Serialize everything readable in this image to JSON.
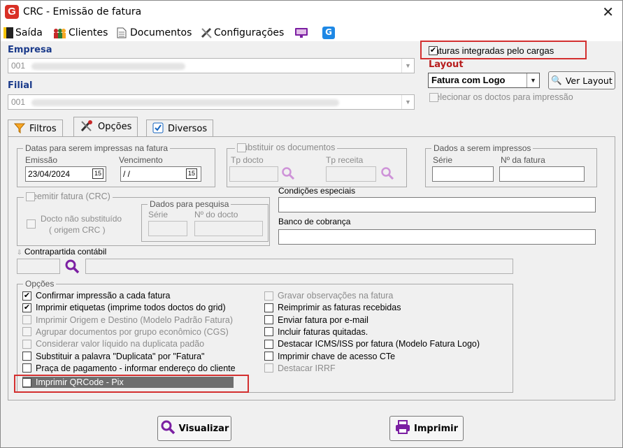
{
  "window": {
    "title": "CRC - Emissão de fatura",
    "close": "✕"
  },
  "menu": {
    "saida": "Saída",
    "clientes": "Clientes",
    "documentos": "Documentos",
    "configuracoes": "Configurações"
  },
  "empresa": {
    "label": "Empresa",
    "value": "001"
  },
  "filial": {
    "label": "Filial",
    "value": "001"
  },
  "faturas_integradas": "Faturas integradas pelo cargas",
  "layout": {
    "label": "Layout",
    "value": "Fatura com Logo",
    "ver_layout": "Ver Layout",
    "selecionar": "Selecionar os doctos para impressão"
  },
  "tabs": {
    "filtros": "Filtros",
    "opcoes": "Opções",
    "diversos": "Diversos"
  },
  "datas": {
    "legend": "Datas para serem impressas na fatura",
    "emissao_label": "Emissão",
    "emissao_value": "23/04/2024",
    "vencimento_label": "Vencimento",
    "vencimento_value": " / /",
    "cal": "15"
  },
  "substituir": {
    "label": "Substituir os documentos",
    "tp_docto": "Tp docto",
    "tp_receita": "Tp receita"
  },
  "dados_impressos": {
    "legend": "Dados a serem impressos",
    "serie": "Série",
    "numero": "Nº da fatura"
  },
  "reemitir": {
    "label": "Reemitir fatura (CRC)",
    "docto_nao_sub": "Docto não substituído",
    "origem": "( origem CRC )"
  },
  "dados_pesquisa": {
    "legend": "Dados para pesquisa",
    "serie": "Série",
    "numero": "Nº do docto"
  },
  "condicoes": "Condições especiais",
  "banco": "Banco de cobrança",
  "contrapartida": "Contrapartida contábil",
  "opcoes": {
    "legend": "Opções",
    "left": [
      {
        "label": "Confirmar impressão a cada fatura",
        "checked": true,
        "enabled": true
      },
      {
        "label": "Imprimir etiquetas (imprime todos doctos do grid)",
        "checked": true,
        "enabled": true
      },
      {
        "label": "Imprimir Origem e Destino (Modelo Padrão Fatura)",
        "checked": false,
        "enabled": false
      },
      {
        "label": "Agrupar documentos por grupo econômico (CGS)",
        "checked": false,
        "enabled": false
      },
      {
        "label": "Considerar valor líquido na duplicata padão",
        "checked": false,
        "enabled": false
      },
      {
        "label": "Substituir a palavra \"Duplicata\" por \"Fatura\"",
        "checked": false,
        "enabled": true
      },
      {
        "label": "Praça de pagamento - informar endereço do cliente",
        "checked": false,
        "enabled": true
      },
      {
        "label": "Imprimir QRCode - Pix",
        "checked": true,
        "enabled": true
      }
    ],
    "right": [
      {
        "label": "Gravar observações na fatura",
        "checked": false,
        "enabled": false
      },
      {
        "label": "Reimprimir as faturas recebidas",
        "checked": false,
        "enabled": true
      },
      {
        "label": "Enviar fatura por e-mail",
        "checked": false,
        "enabled": true
      },
      {
        "label": "Incluir faturas quitadas.",
        "checked": false,
        "enabled": true
      },
      {
        "label": "Destacar ICMS/ISS por fatura (Modelo Fatura Logo)",
        "checked": false,
        "enabled": true
      },
      {
        "label": "Imprimir chave de acesso CTe",
        "checked": false,
        "enabled": true
      },
      {
        "label": "Destacar IRRF",
        "checked": false,
        "enabled": false
      }
    ]
  },
  "buttons": {
    "visualizar": "Visualizar",
    "imprimir": "Imprimir"
  },
  "colors": {
    "highlight": "#d32f2f",
    "label_blue": "#1a3a8a",
    "layout_label": "#b71c1c",
    "search_icon": "#7b1fa2"
  }
}
